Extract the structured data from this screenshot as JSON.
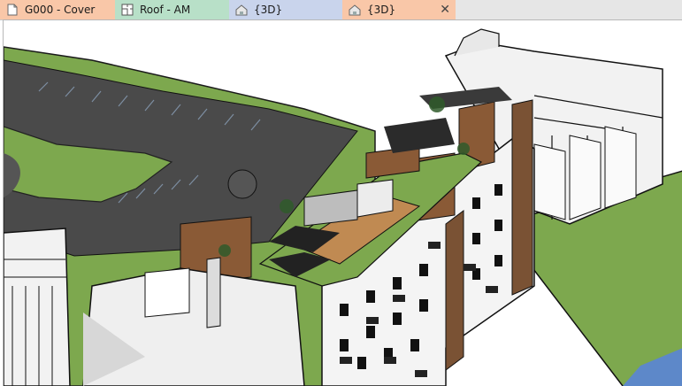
{
  "tabs": [
    {
      "label": "G000 - Cover",
      "icon": "sheet-icon",
      "color": "#f9c7a8"
    },
    {
      "label": "Roof - AM",
      "icon": "floor-plan-icon",
      "color": "#b8e0c8"
    },
    {
      "label": "{3D}",
      "icon": "house-3d-icon",
      "color": "#c9d4ec"
    },
    {
      "label": "{3D}",
      "icon": "house-3d-icon",
      "color": "#f9c7a8",
      "active": true,
      "close": "✕"
    }
  ],
  "viewport": {
    "content": "3d-building-model"
  }
}
